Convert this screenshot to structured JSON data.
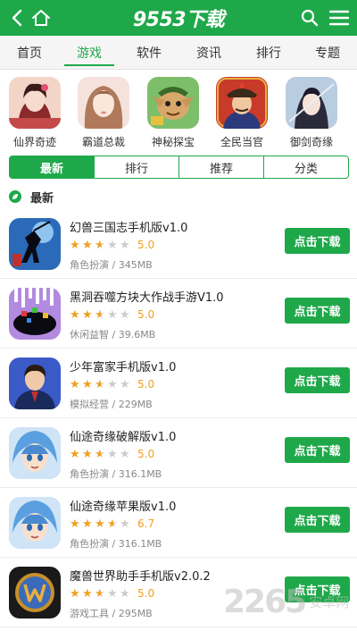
{
  "header": {
    "logo_text": "9553下载",
    "color": "#1fa84a"
  },
  "nav": {
    "tabs": [
      {
        "label": "首页"
      },
      {
        "label": "游戏",
        "active": true
      },
      {
        "label": "软件"
      },
      {
        "label": "资讯"
      },
      {
        "label": "排行"
      },
      {
        "label": "专题"
      }
    ]
  },
  "featured": [
    {
      "label": "仙界奇迹"
    },
    {
      "label": "霸道总裁"
    },
    {
      "label": "神秘探宝"
    },
    {
      "label": "全民当官"
    },
    {
      "label": "御剑奇缘"
    }
  ],
  "segment": {
    "tabs": [
      {
        "label": "最新",
        "active": true
      },
      {
        "label": "排行"
      },
      {
        "label": "推荐"
      },
      {
        "label": "分类"
      }
    ]
  },
  "section": {
    "title": "最新"
  },
  "apps": [
    {
      "name": "幻兽三国志手机版v1.0",
      "rating": 2.5,
      "score": "5.0",
      "meta": "角色扮演 / 345MB",
      "button": "点击下载",
      "icon": "silhouette-warrior-icon"
    },
    {
      "name": "黑洞吞噬方块大作战手游V1.0",
      "rating": 2.5,
      "score": "5.0",
      "meta": "休闲益智 / 39.6MB",
      "button": "点击下载",
      "icon": "black-hole-icon"
    },
    {
      "name": "少年富家手机版v1.0",
      "rating": 2.5,
      "score": "5.0",
      "meta": "模拟经营 / 229MB",
      "button": "点击下载",
      "icon": "businessman-icon"
    },
    {
      "name": "仙途奇缘破解版v1.0",
      "rating": 2.5,
      "score": "5.0",
      "meta": "角色扮演 / 316.1MB",
      "button": "点击下载",
      "icon": "blue-hair-hero-icon"
    },
    {
      "name": "仙途奇缘苹果版v1.0",
      "rating": 3.5,
      "score": "6.7",
      "meta": "角色扮演 / 316.1MB",
      "button": "点击下载",
      "icon": "blue-hair-hero-icon"
    },
    {
      "name": "魔兽世界助手手机版v2.0.2",
      "rating": 2.5,
      "score": "5.0",
      "meta": "游戏工具 / 295MB",
      "button": "点击下载",
      "icon": "wow-logo-icon"
    }
  ],
  "watermark": {
    "number": "2265",
    "suffix": "安卓网"
  }
}
